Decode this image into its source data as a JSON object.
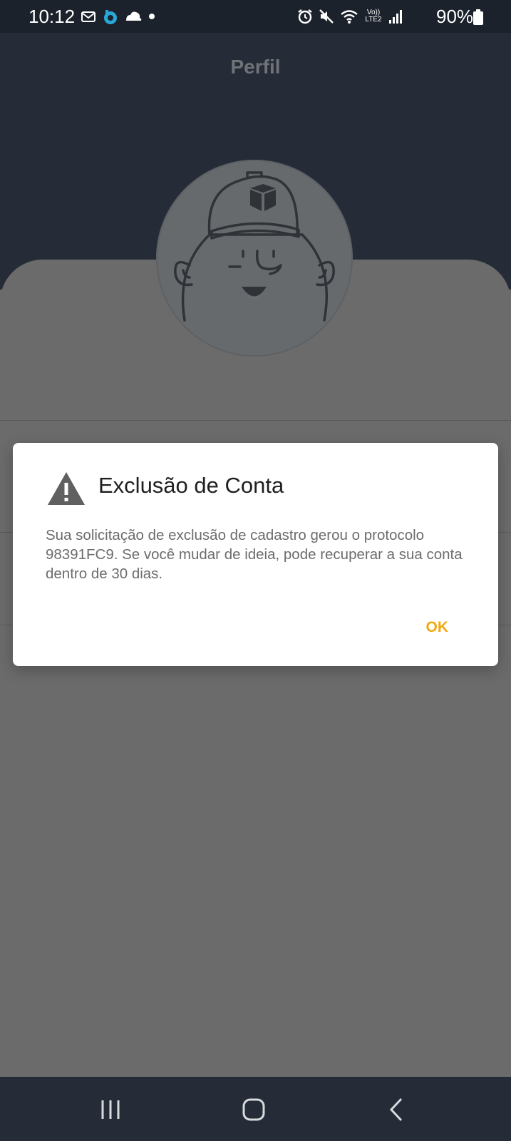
{
  "status_bar": {
    "time": "10:12",
    "battery": "90%",
    "icons_left": [
      "notification-icon",
      "sync-icon",
      "cloud-icon",
      "dot-icon"
    ],
    "icons_right": [
      "alarm-icon",
      "mute-icon",
      "wifi-icon",
      "volte-icon",
      "signal-icon",
      "battery-icon"
    ],
    "volte_text": "Vo)) LTE2"
  },
  "page": {
    "title": "Perfil"
  },
  "dialog": {
    "title": "Exclusão de Conta",
    "message": "Sua solicitação de exclusão de cadastro gerou o protocolo 98391FC9. Se você mudar de ideia, pode recuperar a sua conta dentro de 30 dias.",
    "ok_label": "OK",
    "accent_color": "#f2a90e",
    "icon": "warning-icon"
  },
  "nav_bar": {
    "buttons": [
      "recents-icon",
      "home-icon",
      "back-icon"
    ]
  },
  "colors": {
    "header": "#252c37",
    "overlay": "#6b6b6b",
    "status_bar": "#1b222b"
  }
}
